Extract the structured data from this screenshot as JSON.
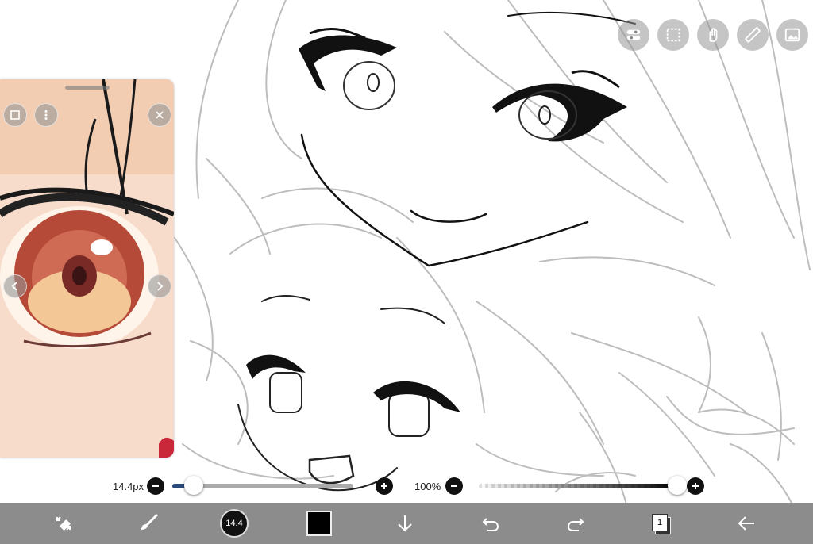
{
  "top_tools": [
    {
      "name": "toggle-icon"
    },
    {
      "name": "selection-icon"
    },
    {
      "name": "gesture-icon"
    },
    {
      "name": "ruler-icon"
    },
    {
      "name": "image-icon"
    }
  ],
  "sliders": {
    "brush_size_label": "14.4px",
    "brush_size_fraction": 0.12,
    "opacity_label": "100%",
    "opacity_fraction": 1.0
  },
  "toolbar": {
    "brush_size_value": "14.4",
    "color": "#000000",
    "layer_count": "1"
  }
}
